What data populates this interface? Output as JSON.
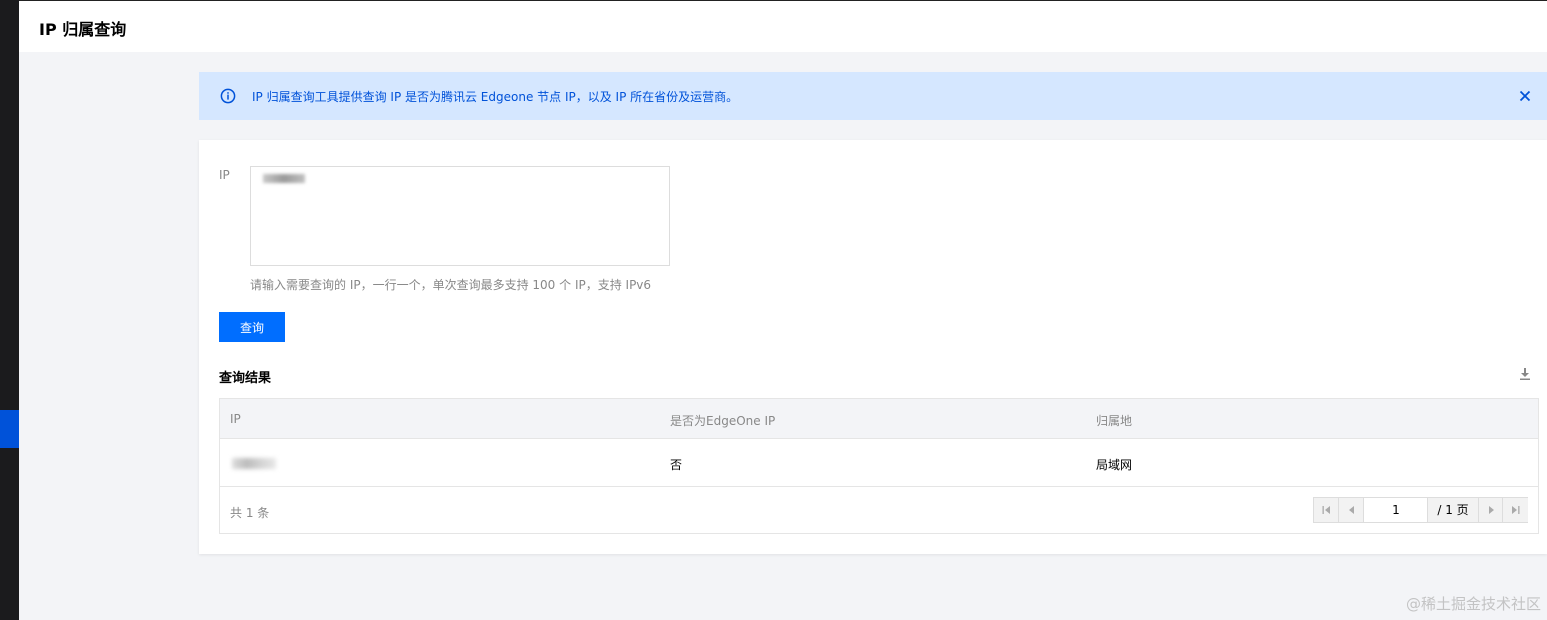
{
  "topbar": {
    "title": "IP 归属查询"
  },
  "notice": {
    "text": "IP 归属查询工具提供查询 IP 是否为腾讯云 Edgeone 节点 IP，以及 IP 所在省份及运营商。",
    "icons": {
      "info": "info-icon",
      "close": "close-icon"
    }
  },
  "form": {
    "ip_label": "IP",
    "ip_value": "",
    "hint": "请输入需要查询的 IP，一行一个，单次查询最多支持 100 个 IP，支持 IPv6",
    "query_button": "查询"
  },
  "results": {
    "title": "查询结果",
    "columns": [
      "IP",
      "是否为EdgeOne IP",
      "归属地"
    ],
    "rows": [
      {
        "ip": "",
        "is_edgeone": "否",
        "location": "局域网"
      }
    ],
    "total_text": "共 1 条",
    "pager": {
      "current": "1",
      "total": "/ 1 页"
    }
  },
  "watermark": "@稀土掘金技术社区",
  "colors": {
    "accent": "#006eff",
    "notice_bg": "#d5e7ff",
    "notice_text": "#0052d9"
  }
}
